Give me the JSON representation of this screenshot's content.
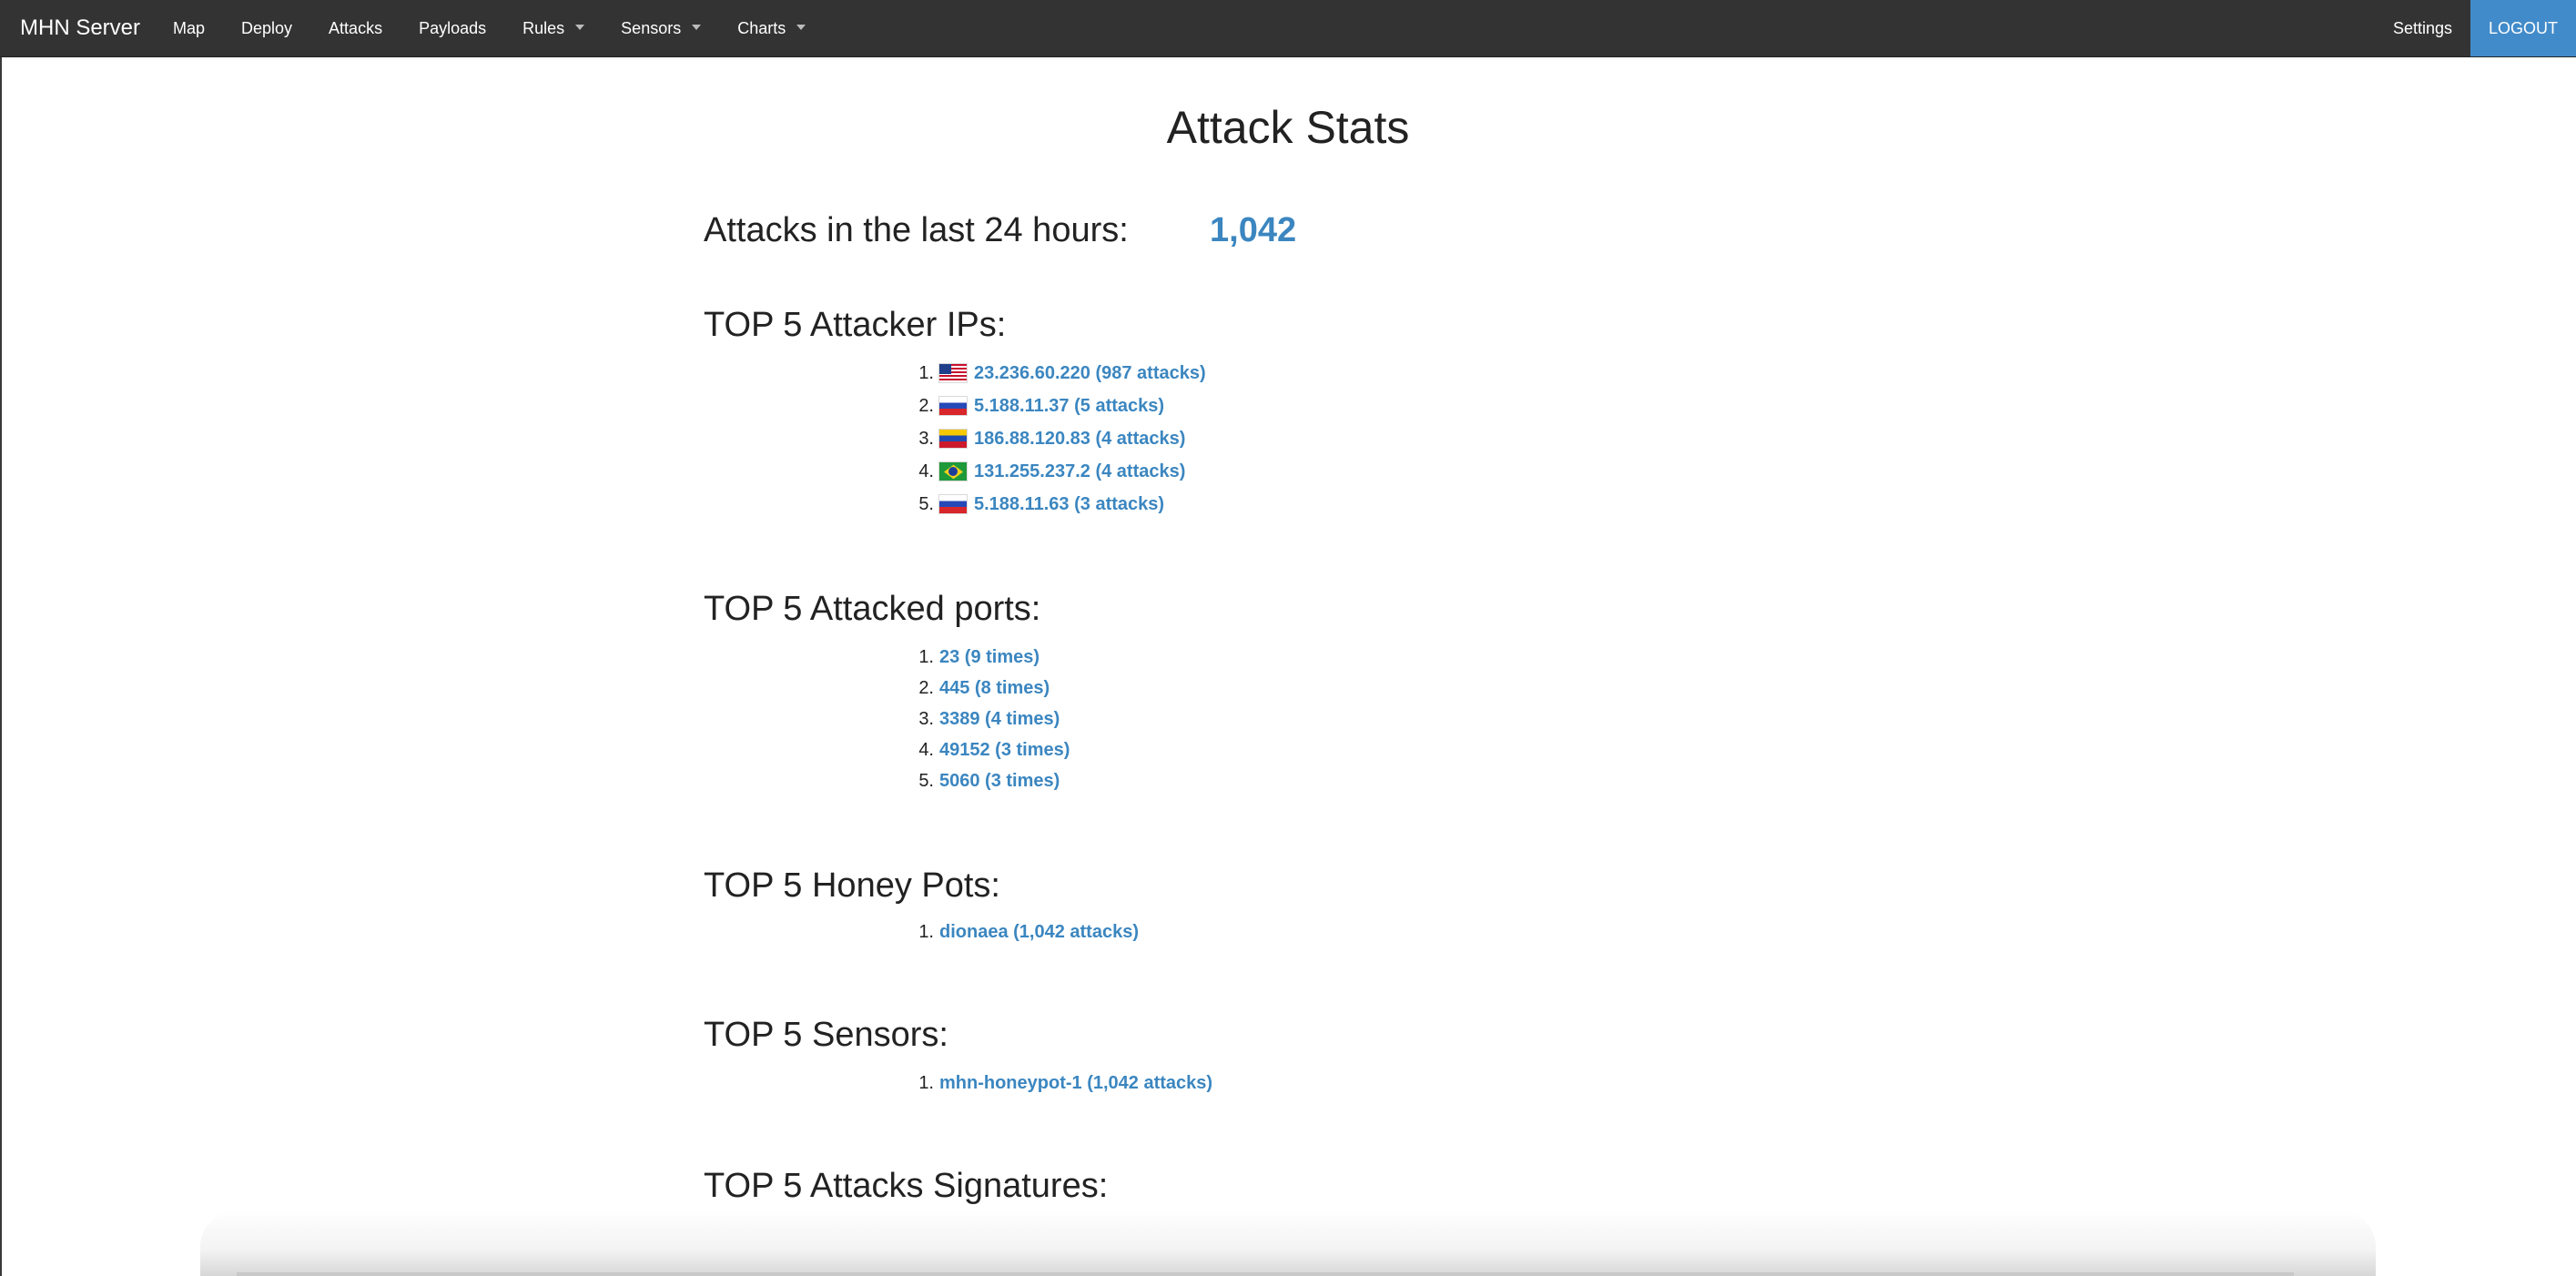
{
  "navbar": {
    "brand": "MHN Server",
    "items": [
      {
        "label": "Map",
        "dropdown": false
      },
      {
        "label": "Deploy",
        "dropdown": false
      },
      {
        "label": "Attacks",
        "dropdown": false
      },
      {
        "label": "Payloads",
        "dropdown": false
      },
      {
        "label": "Rules",
        "dropdown": true
      },
      {
        "label": "Sensors",
        "dropdown": true
      },
      {
        "label": "Charts",
        "dropdown": true
      }
    ],
    "settings_label": "Settings",
    "logout_label": "LOGOUT"
  },
  "colors": {
    "navbar_bg": "#333333",
    "accent": "#428bca",
    "link": "#3b86c0"
  },
  "page": {
    "title": "Attack Stats",
    "attacks_24h_label": "Attacks in the last 24 hours:",
    "attacks_24h_value": "1,042"
  },
  "top_ips": {
    "heading": "TOP 5 Attacker IPs:",
    "items": [
      {
        "rank": "1.",
        "flag": "us-flag-icon",
        "text": "23.236.60.220 (987 attacks)"
      },
      {
        "rank": "2.",
        "flag": "ru-flag-icon",
        "text": "5.188.11.37 (5 attacks)"
      },
      {
        "rank": "3.",
        "flag": "ve-flag-icon",
        "text": "186.88.120.83 (4 attacks)"
      },
      {
        "rank": "4.",
        "flag": "br-flag-icon",
        "text": "131.255.237.2 (4 attacks)"
      },
      {
        "rank": "5.",
        "flag": "ru-flag-icon",
        "text": "5.188.11.63 (3 attacks)"
      }
    ]
  },
  "top_ports": {
    "heading": "TOP 5 Attacked ports:",
    "items": [
      {
        "rank": "1.",
        "text": "23 (9 times)"
      },
      {
        "rank": "2.",
        "text": "445 (8 times)"
      },
      {
        "rank": "3.",
        "text": "3389 (4 times)"
      },
      {
        "rank": "4.",
        "text": "49152 (3 times)"
      },
      {
        "rank": "5.",
        "text": "5060 (3 times)"
      }
    ]
  },
  "top_honeypots": {
    "heading": "TOP 5 Honey Pots:",
    "items": [
      {
        "rank": "1.",
        "text": "dionaea (1,042 attacks)"
      }
    ]
  },
  "top_sensors": {
    "heading": "TOP 5 Sensors:",
    "items": [
      {
        "rank": "1.",
        "text": "mhn-honeypot-1 (1,042 attacks)"
      }
    ]
  },
  "top_signatures": {
    "heading": "TOP 5 Attacks Signatures:"
  }
}
